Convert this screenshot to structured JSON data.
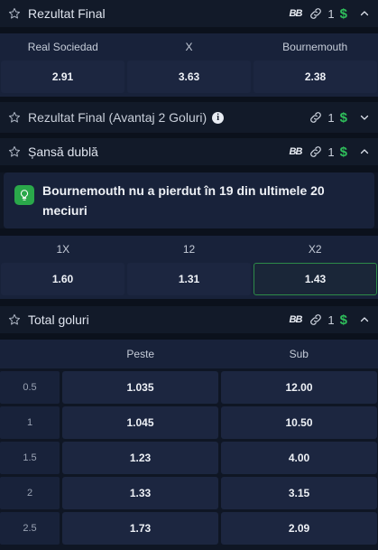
{
  "markets": {
    "result": {
      "title": "Rezultat Final",
      "count": "1",
      "selections": [
        {
          "label": "Real Sociedad",
          "odd": "2.91"
        },
        {
          "label": "X",
          "odd": "3.63"
        },
        {
          "label": "Bournemouth",
          "odd": "2.38"
        }
      ]
    },
    "result_handicap": {
      "title": "Rezultat Final (Avantaj 2 Goluri)",
      "info": "i",
      "count": "1"
    },
    "double_chance": {
      "title": "Șansă dublă",
      "count": "1",
      "tip": "Bournemouth nu a pierdut în 19 din ultimele 20 meciuri",
      "selections": [
        {
          "label": "1X",
          "odd": "1.60"
        },
        {
          "label": "12",
          "odd": "1.31"
        },
        {
          "label": "X2",
          "odd": "1.43",
          "selected": true
        }
      ]
    },
    "total_goals": {
      "title": "Total goluri",
      "count": "1",
      "col_over": "Peste",
      "col_under": "Sub",
      "rows": [
        {
          "line": "0.5",
          "over": "1.035",
          "under": "12.00"
        },
        {
          "line": "1",
          "over": "1.045",
          "under": "10.50"
        },
        {
          "line": "1.5",
          "over": "1.23",
          "under": "4.00"
        },
        {
          "line": "2",
          "over": "1.33",
          "under": "3.15"
        },
        {
          "line": "2.5",
          "over": "1.73",
          "under": "2.09"
        }
      ]
    }
  },
  "icons": {
    "bet_builder": "BB",
    "dollar": "$",
    "accent_green": "#2fbf5b"
  }
}
